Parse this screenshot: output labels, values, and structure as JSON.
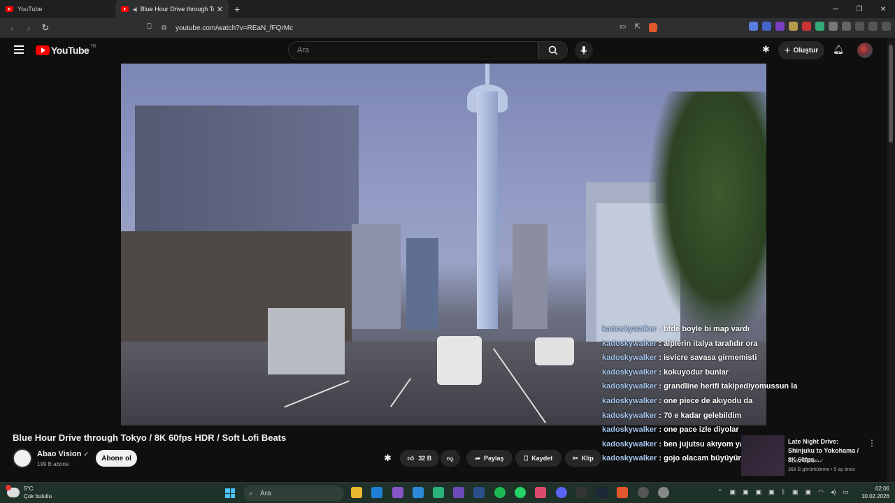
{
  "browser": {
    "tabs": [
      {
        "label": "YouTube",
        "active": false
      },
      {
        "label": "Blue Hour Drive through Toky",
        "active": true
      }
    ],
    "new_tab": "+",
    "url": "youtube.com/watch?v=REaN_fFQrMc"
  },
  "youtube": {
    "logo": "YouTube",
    "logo_region": "TR",
    "search_placeholder": "Ara",
    "create_label": "Oluştur"
  },
  "video": {
    "title": "Blue Hour Drive through Tokyo / 8K 60fps HDR / Soft Lofi Beats",
    "channel": "Abao Vision",
    "subscribers": "199 B abone",
    "subscribe_label": "Abone ol",
    "likes": "32 B",
    "share_label": "Paylaş",
    "save_label": "Kaydet",
    "clip_label": "Klip"
  },
  "chat": [
    {
      "user": "kadoskywalker",
      "msg": "bfde boyle bi map vardı"
    },
    {
      "user": "kadoskywalker",
      "msg": "alplerin italya tarafıdır ora"
    },
    {
      "user": "kadoskywalker",
      "msg": "isvicre savasa girmemisti"
    },
    {
      "user": "kadoskywalker",
      "msg": "kokuyodur bunlar"
    },
    {
      "user": "kadoskywalker",
      "msg": "grandline herifi takipediyomussun la"
    },
    {
      "user": "kadoskywalker",
      "msg": "one piece de akıyodu da"
    },
    {
      "user": "kadoskywalker",
      "msg": "70 e kadar gelebildim"
    },
    {
      "user": "kadoskywalker",
      "msg": "one pace izle diyolar"
    },
    {
      "user": "kadoskywalker",
      "msg": "ben jujutsu akıyom ya artık"
    },
    {
      "user": "kadoskywalker",
      "msg": "gojo olacam büyüyünce"
    }
  ],
  "recommended": {
    "title": "Late Night Drive: Shinjuku to Yokohama / 8K 60fps...",
    "channel": "Abao Vision",
    "views": "368 B görüntüleme • 5 ay önce"
  },
  "taskbar": {
    "temperature": "5°C",
    "weather": "Çok bulutlu",
    "search": "Ara",
    "time": "02:06",
    "date": "10.02.2026"
  },
  "colors": {
    "brand_red": "#ff0000",
    "chat_user": "#a8c8f0",
    "page_bg": "#0f0f0f"
  }
}
